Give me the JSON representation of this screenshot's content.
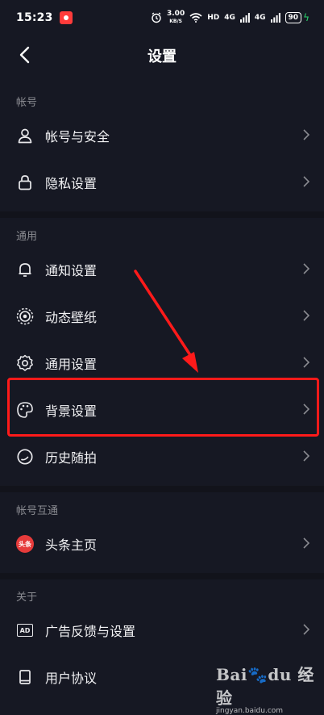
{
  "status_bar": {
    "time": "15:23",
    "net_speed_value": "3.00",
    "net_speed_unit": "KB/S",
    "hd_label": "HD",
    "signal_label_1": "4G",
    "signal_label_2": "4G",
    "battery_level": "90"
  },
  "header": {
    "title": "设置"
  },
  "sections": [
    {
      "title": "帐号",
      "items": [
        {
          "label": "帐号与安全",
          "icon": "user-icon"
        },
        {
          "label": "隐私设置",
          "icon": "lock-icon"
        }
      ]
    },
    {
      "title": "通用",
      "items": [
        {
          "label": "通知设置",
          "icon": "bell-icon"
        },
        {
          "label": "动态壁纸",
          "icon": "live-wallpaper-icon"
        },
        {
          "label": "通用设置",
          "icon": "gear-icon"
        },
        {
          "label": "背景设置",
          "icon": "palette-icon"
        },
        {
          "label": "历史随拍",
          "icon": "history-icon"
        }
      ]
    },
    {
      "title": "帐号互通",
      "items": [
        {
          "label": "头条主页",
          "icon": "toutiao-icon",
          "badge": "头条"
        }
      ]
    },
    {
      "title": "关于",
      "items": [
        {
          "label": "广告反馈与设置",
          "icon": "ad-icon",
          "badge": "AD"
        },
        {
          "label": "用户协议",
          "icon": "book-icon"
        }
      ]
    }
  ],
  "annotation": {
    "highlight_color": "#ff1a1a"
  },
  "watermark": {
    "logo_a": "Bai",
    "logo_b": "du",
    "logo_c": "经验",
    "url": "jingyan.baidu.com"
  }
}
